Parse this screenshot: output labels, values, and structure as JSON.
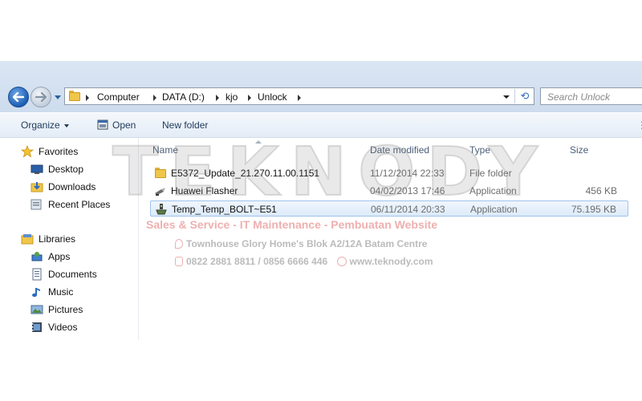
{
  "address_bar": {
    "crumbs": [
      "Computer",
      "DATA (D:)",
      "kjo",
      "Unlock"
    ]
  },
  "search": {
    "placeholder": "Search Unlock"
  },
  "toolbar": {
    "organize_label": "Organize",
    "open_label": "Open",
    "new_folder_label": "New folder"
  },
  "sidebar": {
    "favorites": {
      "label": "Favorites",
      "items": [
        {
          "label": "Desktop",
          "icon": "desktop-icon"
        },
        {
          "label": "Downloads",
          "icon": "downloads-icon"
        },
        {
          "label": "Recent Places",
          "icon": "recent-places-icon"
        }
      ]
    },
    "libraries": {
      "label": "Libraries",
      "items": [
        {
          "label": "Apps",
          "icon": "apps-icon"
        },
        {
          "label": "Documents",
          "icon": "documents-icon"
        },
        {
          "label": "Music",
          "icon": "music-icon"
        },
        {
          "label": "Pictures",
          "icon": "pictures-icon"
        },
        {
          "label": "Videos",
          "icon": "videos-icon"
        }
      ]
    }
  },
  "file_list": {
    "columns": {
      "name": "Name",
      "date": "Date modified",
      "type": "Type",
      "size": "Size"
    },
    "rows": [
      {
        "name": "E5372_Update_21.270.11.00.1151",
        "date": "11/12/2014 22:33",
        "type": "File folder",
        "size": "",
        "icon": "folder-icon",
        "selected": false
      },
      {
        "name": "Huawei Flasher",
        "date": "04/02/2013 17:46",
        "type": "Application",
        "size": "456 KB",
        "icon": "application-icon",
        "selected": false
      },
      {
        "name": "Temp_Temp_BOLT~E51",
        "date": "06/11/2014 20:33",
        "type": "Application",
        "size": "75.195 KB",
        "icon": "application-icon",
        "selected": true
      }
    ]
  },
  "watermark": {
    "logo": "TEKNODY",
    "line1": "Sales & Service - IT Maintenance - Pembuatan Website",
    "address": "Townhouse Glory Home's Blok A2/12A Batam Centre",
    "phones": "0822 2881 8811 / 0856 6666 446",
    "website": "www.teknody.com"
  },
  "colors": {
    "nav_gradient": "#cddcee",
    "selection_border": "#9ec3ec",
    "toolbar_text": "#1e395b",
    "watermark_red": "#e16e6e"
  }
}
